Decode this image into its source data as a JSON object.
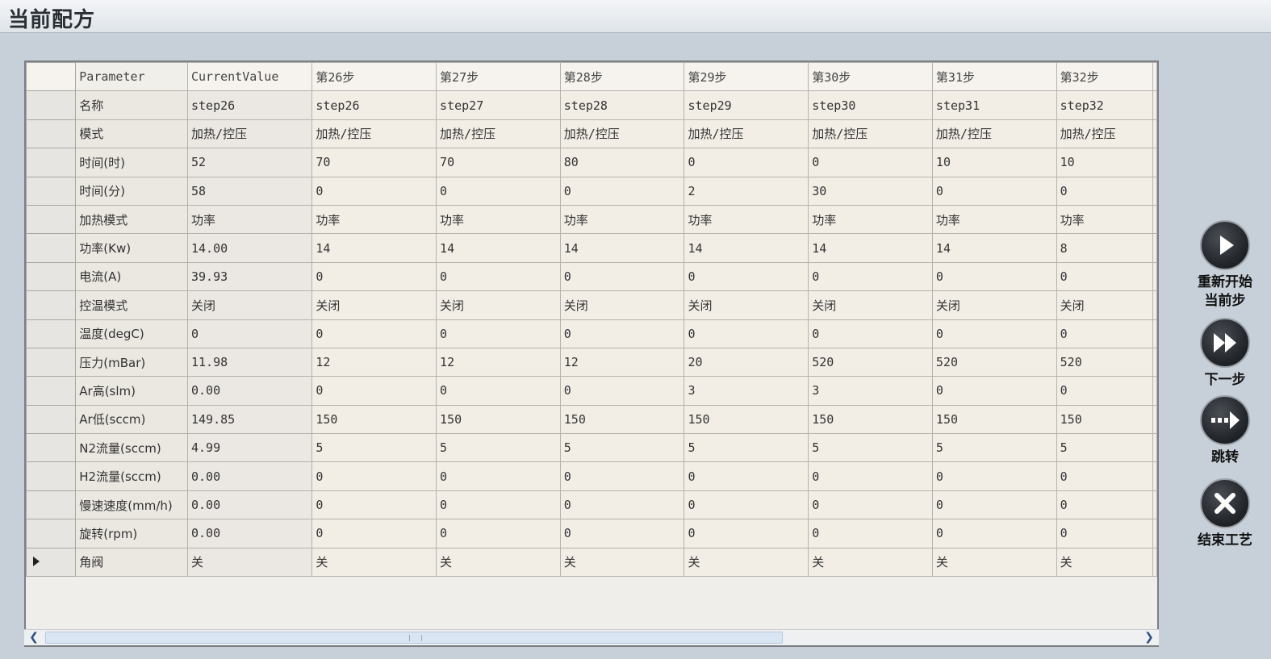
{
  "window": {
    "title": "当前配方"
  },
  "grid": {
    "header": [
      "Parameter",
      "CurrentValue",
      "第26步",
      "第27步",
      "第28步",
      "第29步",
      "第30步",
      "第31步",
      "第32步"
    ],
    "rows": [
      [
        "名称",
        "step26",
        "step26",
        "step27",
        "step28",
        "step29",
        "step30",
        "step31",
        "step32"
      ],
      [
        "模式",
        "加热/控压",
        "加热/控压",
        "加热/控压",
        "加热/控压",
        "加热/控压",
        "加热/控压",
        "加热/控压",
        "加热/控压"
      ],
      [
        "时间(时)",
        "52",
        "70",
        "70",
        "80",
        "0",
        "0",
        "10",
        "10"
      ],
      [
        "时间(分)",
        "58",
        "0",
        "0",
        "0",
        "2",
        "30",
        "0",
        "0"
      ],
      [
        "加热模式",
        "功率",
        "功率",
        "功率",
        "功率",
        "功率",
        "功率",
        "功率",
        "功率"
      ],
      [
        "功率(Kw)",
        "14.00",
        "14",
        "14",
        "14",
        "14",
        "14",
        "14",
        "8"
      ],
      [
        "电流(A)",
        "39.93",
        "0",
        "0",
        "0",
        "0",
        "0",
        "0",
        "0"
      ],
      [
        "控温模式",
        "关闭",
        "关闭",
        "关闭",
        "关闭",
        "关闭",
        "关闭",
        "关闭",
        "关闭"
      ],
      [
        "温度(degC)",
        "0",
        "0",
        "0",
        "0",
        "0",
        "0",
        "0",
        "0"
      ],
      [
        "压力(mBar)",
        "11.98",
        "12",
        "12",
        "12",
        "20",
        "520",
        "520",
        "520"
      ],
      [
        "Ar高(slm)",
        "0.00",
        "0",
        "0",
        "0",
        "3",
        "3",
        "0",
        "0"
      ],
      [
        "Ar低(sccm)",
        "149.85",
        "150",
        "150",
        "150",
        "150",
        "150",
        "150",
        "150"
      ],
      [
        "N2流量(sccm)",
        "4.99",
        "5",
        "5",
        "5",
        "5",
        "5",
        "5",
        "5"
      ],
      [
        "H2流量(sccm)",
        "0.00",
        "0",
        "0",
        "0",
        "0",
        "0",
        "0",
        "0"
      ],
      [
        "慢速速度(mm/h)",
        "0.00",
        "0",
        "0",
        "0",
        "0",
        "0",
        "0",
        "0"
      ],
      [
        "旋转(rpm)",
        "0.00",
        "0",
        "0",
        "0",
        "0",
        "0",
        "0",
        "0"
      ],
      [
        "角阀",
        "关",
        "关",
        "关",
        "关",
        "关",
        "关",
        "关",
        "关"
      ]
    ],
    "current_row_marker": "play-right-icon"
  },
  "scrollbar": {
    "left_icon": "chevron-left-icon",
    "right_icon": "chevron-right-icon"
  },
  "buttons": {
    "restart": {
      "label": "重新开始\n当前步",
      "icon": "play-icon"
    },
    "next": {
      "label": "下一步",
      "icon": "fast-forward-icon"
    },
    "jump": {
      "label": "跳转",
      "icon": "jump-icon"
    },
    "end": {
      "label": "结束工艺",
      "icon": "close-icon"
    }
  }
}
